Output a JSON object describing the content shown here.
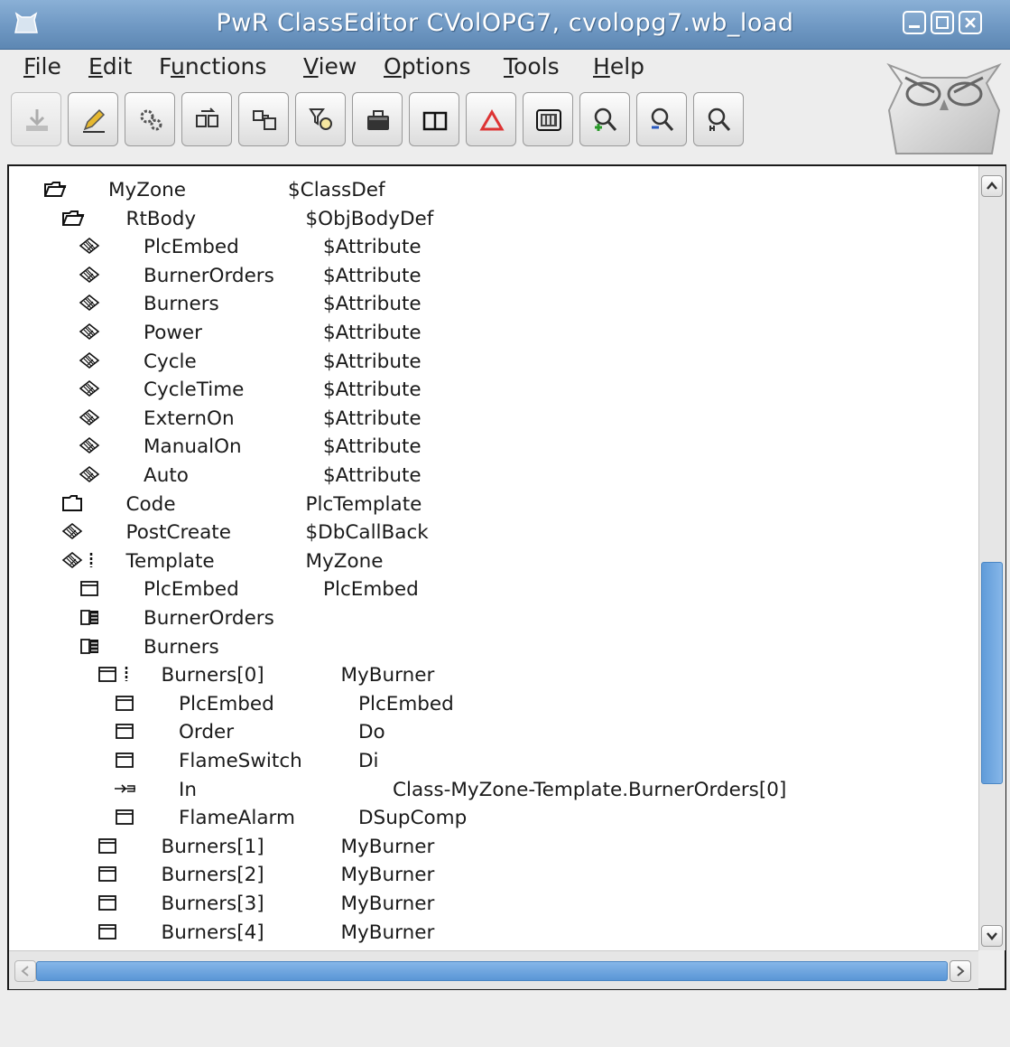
{
  "window": {
    "title": "PwR ClassEditor CVolOPG7,    cvolopg7.wb_load"
  },
  "menu": [
    {
      "label": "File",
      "ul": "F",
      "rest": "ile"
    },
    {
      "label": "Edit",
      "ul": "E",
      "rest": "dit"
    },
    {
      "label": "Functions",
      "ul": "",
      "pre": "F",
      "mid": "u",
      "rest": "nctions"
    },
    {
      "label": "View",
      "ul": "V",
      "rest": "iew"
    },
    {
      "label": "Options",
      "ul": "O",
      "rest": "ptions"
    },
    {
      "label": "Tools",
      "ul": "T",
      "rest": "ools"
    },
    {
      "label": "Help",
      "ul": "H",
      "rest": "elp"
    }
  ],
  "toolbar": [
    "save-icon",
    "edit-icon",
    "build-icon",
    "move-objects-icon",
    "create-objects-icon",
    "filter-icon",
    "case-icon",
    "two-panes-icon",
    "alarm-triangle-icon",
    "object-display-icon",
    "zoom-in-icon",
    "zoom-out-icon",
    "zoom-reset-icon"
  ],
  "tree": [
    {
      "icon": "folder-open",
      "name": "MyZone",
      "cls": "$ClassDef",
      "indent": 0
    },
    {
      "icon": "folder-open",
      "name": "RtBody",
      "cls": "$ObjBodyDef",
      "indent": 1
    },
    {
      "icon": "leaf",
      "name": "PlcEmbed",
      "cls": "$Attribute",
      "indent": 2
    },
    {
      "icon": "leaf",
      "name": "BurnerOrders",
      "cls": "$Attribute",
      "indent": 2
    },
    {
      "icon": "leaf",
      "name": "Burners",
      "cls": "$Attribute",
      "indent": 2
    },
    {
      "icon": "leaf",
      "name": "Power",
      "cls": "$Attribute",
      "indent": 2
    },
    {
      "icon": "leaf",
      "name": "Cycle",
      "cls": "$Attribute",
      "indent": 2
    },
    {
      "icon": "leaf",
      "name": "CycleTime",
      "cls": "$Attribute",
      "indent": 2
    },
    {
      "icon": "leaf",
      "name": "ExternOn",
      "cls": "$Attribute",
      "indent": 2
    },
    {
      "icon": "leaf",
      "name": "ManualOn",
      "cls": "$Attribute",
      "indent": 2
    },
    {
      "icon": "leaf",
      "name": "Auto",
      "cls": "$Attribute",
      "indent": 2
    },
    {
      "icon": "folder",
      "name": "Code",
      "cls": "PlcTemplate",
      "indent": 1
    },
    {
      "icon": "leaf",
      "name": "PostCreate",
      "cls": "$DbCallBack",
      "indent": 1
    },
    {
      "icon": "leaf-map",
      "name": "Template",
      "cls": "MyZone",
      "indent": 1
    },
    {
      "icon": "object",
      "name": "PlcEmbed",
      "cls": "PlcEmbed",
      "indent": 2
    },
    {
      "icon": "array",
      "name": "BurnerOrders",
      "cls": "",
      "indent": 2
    },
    {
      "icon": "array",
      "name": "Burners",
      "cls": "",
      "indent": 2
    },
    {
      "icon": "object-map",
      "name": "Burners[0]",
      "cls": "MyBurner",
      "indent": 3
    },
    {
      "icon": "object",
      "name": "PlcEmbed",
      "cls": "PlcEmbed",
      "indent": 4
    },
    {
      "icon": "object",
      "name": "Order",
      "cls": "Do",
      "indent": 4
    },
    {
      "icon": "object",
      "name": "FlameSwitch",
      "cls": "Di",
      "indent": 4
    },
    {
      "icon": "input",
      "name": "In",
      "cls": "Class-MyZone-Template.BurnerOrders[0]",
      "indent": 4,
      "wide": true
    },
    {
      "icon": "object",
      "name": "FlameAlarm",
      "cls": "DSupComp",
      "indent": 4
    },
    {
      "icon": "object",
      "name": "Burners[1]",
      "cls": "MyBurner",
      "indent": 3
    },
    {
      "icon": "object",
      "name": "Burners[2]",
      "cls": "MyBurner",
      "indent": 3
    },
    {
      "icon": "object",
      "name": "Burners[3]",
      "cls": "MyBurner",
      "indent": 3
    },
    {
      "icon": "object",
      "name": "Burners[4]",
      "cls": "MyBurner",
      "indent": 3
    }
  ],
  "colors": {
    "titlebar": "#6f98c3",
    "scroll_thumb": "#6aa6e2"
  }
}
